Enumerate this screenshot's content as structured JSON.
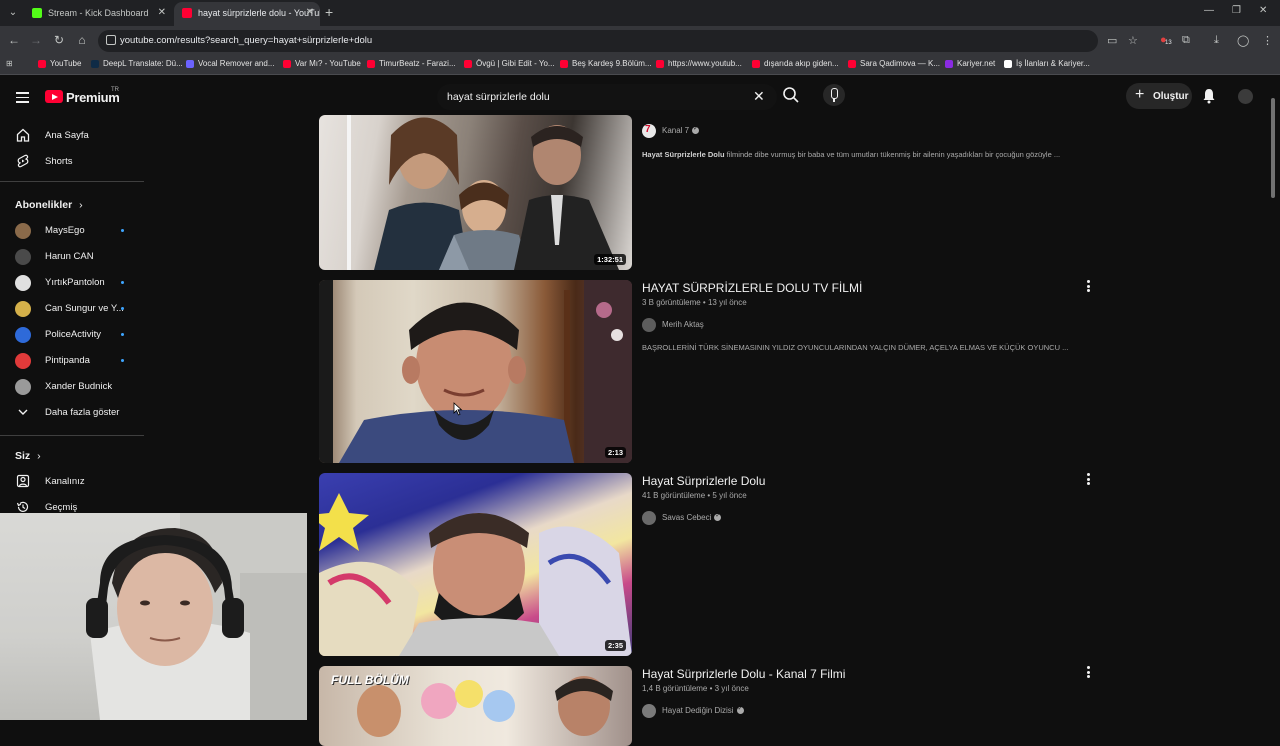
{
  "browser": {
    "tabs": [
      {
        "label": "Stream - Kick Dashboard",
        "color": "#53fc18"
      },
      {
        "label": "hayat sürprizlerle dolu - YouTube",
        "color": "#ff0033"
      }
    ],
    "url": "youtube.com/results?search_query=hayat+sürprizlerle+dolu",
    "bookmarks": [
      "YouTube",
      "DeepL Translate: Dü...",
      "Vocal Remover and...",
      "Var Mı? - YouTube",
      "TimurBeatz - Farazi...",
      "Övgü | Gibi Edit - Yo...",
      "Beş Kardeş 9.Bölüm...",
      "https://www.youtub...",
      "dışarıda akıp giden...",
      "Sara Qadimova — K...",
      "Kariyer.net",
      "İş İlanları & Kariyer..."
    ],
    "extension_badge": "13"
  },
  "header": {
    "brand": "Premium",
    "brand_sup": "TR",
    "search_query": "hayat sürprizlerle dolu",
    "create_label": "Oluştur"
  },
  "sidebar": {
    "main": [
      {
        "label": "Ana Sayfa",
        "icon": "home-icon"
      },
      {
        "label": "Shorts",
        "icon": "shorts-icon"
      }
    ],
    "subs_header": "Abonelikler",
    "subscriptions": [
      {
        "label": "MaysEgo",
        "color": "#8a6a4a",
        "dot": true
      },
      {
        "label": "Harun CAN",
        "color": "#4a4a4a",
        "dot": false
      },
      {
        "label": "YırtıkPantolon",
        "color": "#e0e0e0",
        "dot": true
      },
      {
        "label": "Can Sungur ve Y...",
        "color": "#d4b04a",
        "dot": true
      },
      {
        "label": "PoliceActivity",
        "color": "#2e6ad9",
        "dot": true
      },
      {
        "label": "Pintipanda",
        "color": "#e03a3a",
        "dot": true
      },
      {
        "label": "Xander Budnick",
        "color": "#9a9a9a",
        "dot": false
      }
    ],
    "show_more": "Daha fazla göster",
    "you_header": "Siz",
    "you_items": [
      {
        "label": "Kanalınız"
      },
      {
        "label": "Geçmiş"
      }
    ]
  },
  "results": [
    {
      "title": "",
      "meta": "",
      "channel": "Kanal 7",
      "verified": true,
      "desc_bold": "Hayat Sürprizlerle Dolu",
      "desc": " filminde dibe vurmuş bir baba ve tüm umutları tükenmiş bir ailenin yaşadıkları bir çocuğun gözüyle ...",
      "duration": "1:32:51"
    },
    {
      "title": "HAYAT SÜRPRİZLERLE DOLU TV FİLMİ",
      "meta": "3 B görüntüleme • 13 yıl önce",
      "channel": "Merih Aktaş",
      "verified": false,
      "desc_bold": "",
      "desc": "BAŞROLLERİNİ TÜRK SİNEMASININ YILDIZ OYUNCULARINDAN YALÇIN DÜMER, AÇELYA ELMAS VE KÜÇÜK OYUNCU ...",
      "duration": "2:13"
    },
    {
      "title": "Hayat Sürprizlerle Dolu",
      "meta": "41 B görüntüleme • 5 yıl önce",
      "channel": "Savas Cebeci",
      "verified": true,
      "desc_bold": "",
      "desc": "",
      "duration": "2:35"
    },
    {
      "title": "Hayat Sürprizlerle Dolu - Kanal 7 Filmi",
      "meta": "1,4 B görüntüleme • 3 yıl önce",
      "channel": "Hayat Dediğin Dizisi",
      "verified": true,
      "desc_bold": "",
      "desc": "",
      "duration": "",
      "thumb_text": "FULL BÖLÜM"
    }
  ]
}
